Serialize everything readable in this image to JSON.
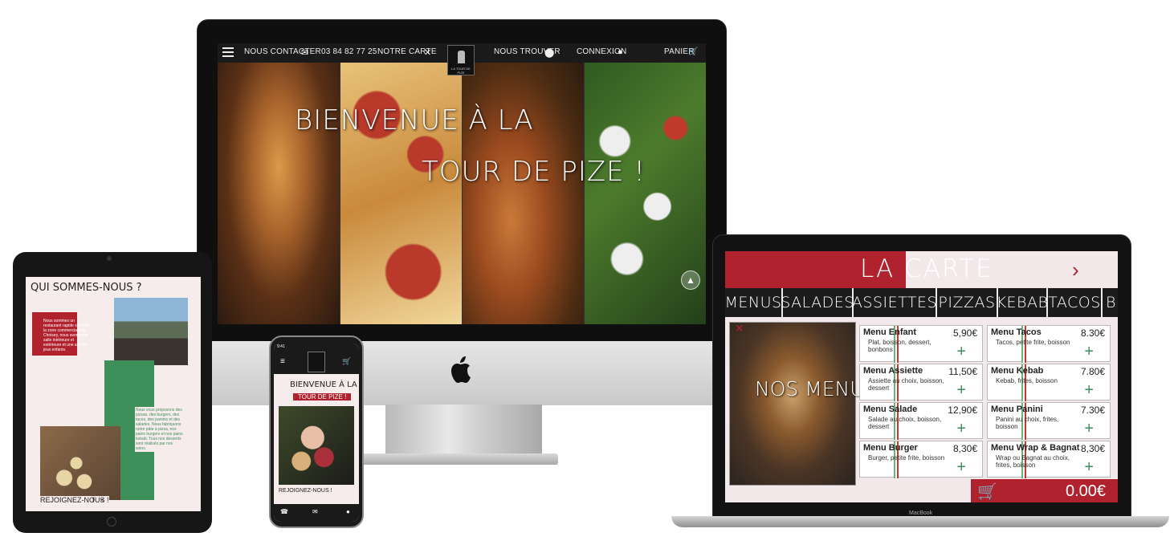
{
  "desktop": {
    "nav": {
      "contact": "NOUS CONTACTER",
      "phone": "03 84 82 77 25",
      "carte": "NOTRE CARTE",
      "trouver": "NOUS TROUVER",
      "connexion": "CONNEXION",
      "panier": "PANIER",
      "logo": "LA TOUR DE PIZE"
    },
    "hero": {
      "line1": "BIENVENUE À LA",
      "line2": "TOUR DE PIZE !"
    }
  },
  "tablet": {
    "title": "QUI SOMMES-NOUS ?",
    "intro": "Nous sommes un restaurant rapide situé sur la zone commerciale de Choisey, nous avons une salle intérieure et extérieure et une aire de jeux enfants.",
    "fabric": "Nous vous proposons des pizzas, des burgers, des tacos, des paninis et des salades. Nous fabriquons notre pâte à pizza, nos pains burgers et nos pains kebab. Tous nos desserts sont réalisés par nos soins.",
    "join": "REJOIGNEZ-NOUS !"
  },
  "phone": {
    "time": "9:41",
    "line1": "BIENVENUE À LA",
    "line2": "TOUR DE PIZE !",
    "join": "REJOIGNEZ-NOUS !"
  },
  "laptop": {
    "title": "LA CARTE",
    "tabs": [
      "MENUS",
      "SALADES",
      "ASSIETTES",
      "PIZZAS",
      "KEBAB",
      "TACOS",
      "BU"
    ],
    "section": "NOS MENUS",
    "items_left": [
      {
        "name": "Menu Enfant",
        "price": "5,90€",
        "desc": "Plat, boisson, dessert, bonbons"
      },
      {
        "name": "Menu Assiette",
        "price": "11,50€",
        "desc": "Assiette au choix, boisson, dessert"
      },
      {
        "name": "Menu Salade",
        "price": "12,90€",
        "desc": "Salade au choix, boisson, dessert"
      },
      {
        "name": "Menu Burger",
        "price": "8,30€",
        "desc": "Burger, petite frite, boisson"
      }
    ],
    "items_right": [
      {
        "name": "Menu Tacos",
        "price": "8.30€",
        "desc": "Tacos, petite frite, boisson"
      },
      {
        "name": "Menu Kebab",
        "price": "7.80€",
        "desc": "Kebab, frites, boisson"
      },
      {
        "name": "Menu Panini",
        "price": "7.30€",
        "desc": "Panini au choix, frites, boisson"
      },
      {
        "name": "Menu Wrap & Bagnat",
        "price": "8,30€",
        "desc": "Wrap ou Bagnat au choix, frites, boisson"
      }
    ],
    "total": "0.00€",
    "brand": "MacBook"
  },
  "colors": {
    "brand_red": "#b0222e",
    "brand_green": "#3f8f5a",
    "background_pink": "#f3e9ea"
  }
}
